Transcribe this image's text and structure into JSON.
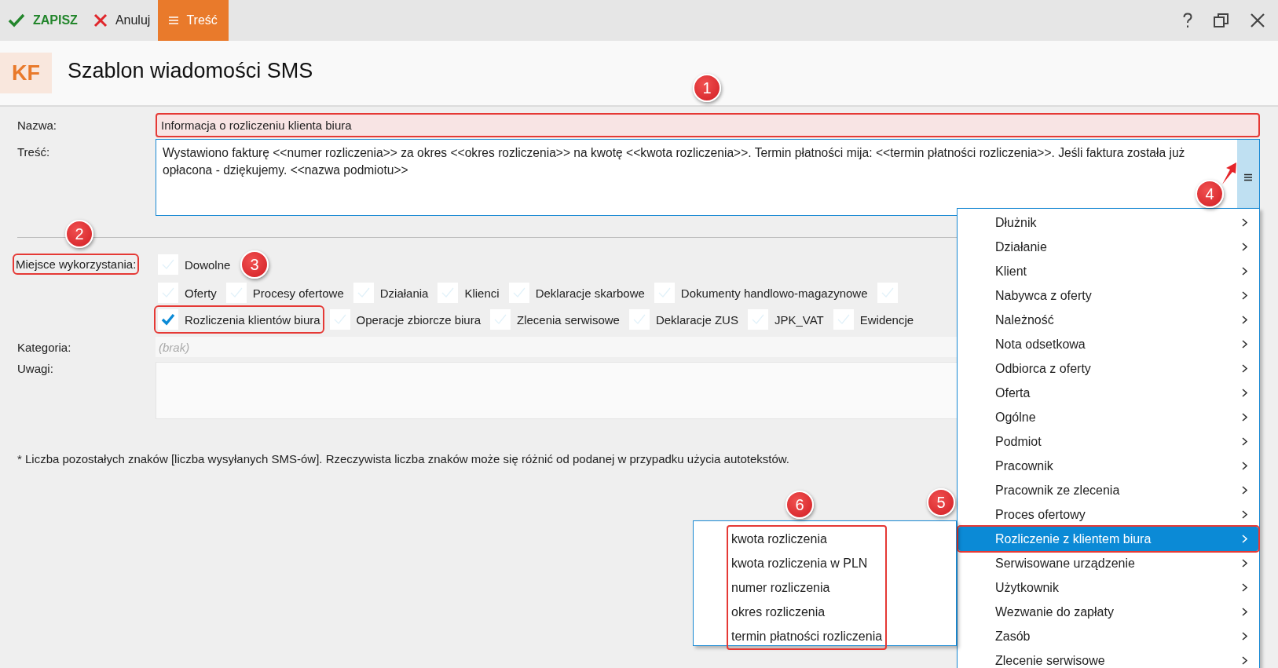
{
  "toolbar": {
    "buttons": [
      {
        "kind": "save",
        "label": "ZAPISZ"
      },
      {
        "kind": "cancel",
        "label": "Anuluj"
      },
      {
        "kind": "tab",
        "label": "Treść",
        "selected": true
      }
    ]
  },
  "header": {
    "logo": "KF",
    "title": "Szablon wiadomości SMS"
  },
  "form": {
    "name": {
      "label": "Nazwa:",
      "value": "Informacja o rozliczeniu klienta biura",
      "highlighted": true
    },
    "content": {
      "label": "Treść:",
      "value": "Wystawiono fakturę <<numer rozliczenia>> za okres <<okres rozliczenia>> na kwotę <<kwota rozliczenia>>. Termin płatności mija: <<termin płatności rozliczenia>>. Jeśli faktura została już opłacona - dziękujemy. <<nazwa podmiotu>>"
    },
    "usage": {
      "label": "Miejsce wykorzystania:",
      "highlighted": true,
      "options": [
        {
          "kind": "any",
          "label": "Dowolne",
          "checked": false,
          "highlighted": false
        },
        {
          "kind": "place",
          "label": "Oferty",
          "checked": false,
          "highlighted": false
        },
        {
          "kind": "place",
          "label": "Procesy ofertowe",
          "checked": false,
          "highlighted": false
        },
        {
          "kind": "place",
          "label": "Działania",
          "checked": false,
          "highlighted": false
        },
        {
          "kind": "place",
          "label": "Klienci",
          "checked": false,
          "highlighted": false
        },
        {
          "kind": "place",
          "label": "Deklaracje skarbowe",
          "checked": false,
          "highlighted": false
        },
        {
          "kind": "place",
          "label": "Dokumenty handlowo-magazynowe",
          "checked": false,
          "highlighted": false
        },
        {
          "kind": "place",
          "checked": false,
          "highlighted": false
        },
        {
          "kind": "place",
          "label": "Rozliczenia klientów biura",
          "checked": true,
          "highlighted": true
        },
        {
          "kind": "place",
          "label": "Operacje zbiorcze biura",
          "checked": false,
          "highlighted": false
        },
        {
          "kind": "place",
          "label": "Zlecenia serwisowe",
          "checked": false,
          "highlighted": false
        },
        {
          "kind": "place",
          "label": "Deklaracje ZUS",
          "checked": false,
          "highlighted": false
        },
        {
          "kind": "place",
          "label": "JPK_VAT",
          "checked": false,
          "highlighted": false
        },
        {
          "kind": "place",
          "label": "Ewidencje",
          "checked": false,
          "highlighted": false
        }
      ]
    },
    "category": {
      "label": "Kategoria:",
      "placeholder": "(brak)"
    },
    "notes": {
      "label": "Uwagi:"
    },
    "footnote": "* Liczba pozostałych znaków [liczba wysyłanych SMS-ów]. Rzeczywista liczba znaków może się różnić od podanej w przypadku użycia autotekstów."
  },
  "menu": {
    "items": [
      {
        "label": "Dłużnik",
        "selected": false,
        "highlighted": false
      },
      {
        "label": "Działanie",
        "selected": false,
        "highlighted": false
      },
      {
        "label": "Klient",
        "selected": false,
        "highlighted": false
      },
      {
        "label": "Nabywca z oferty",
        "selected": false,
        "highlighted": false
      },
      {
        "label": "Należność",
        "selected": false,
        "highlighted": false
      },
      {
        "label": "Nota odsetkowa",
        "selected": false,
        "highlighted": false
      },
      {
        "label": "Odbiorca z oferty",
        "selected": false,
        "highlighted": false
      },
      {
        "label": "Oferta",
        "selected": false,
        "highlighted": false
      },
      {
        "label": "Ogólne",
        "selected": false,
        "highlighted": false
      },
      {
        "label": "Podmiot",
        "selected": false,
        "highlighted": false
      },
      {
        "label": "Pracownik",
        "selected": false,
        "highlighted": false
      },
      {
        "label": "Pracownik ze zlecenia",
        "selected": false,
        "highlighted": false
      },
      {
        "label": "Proces ofertowy",
        "selected": false,
        "highlighted": false
      },
      {
        "label": "Rozliczenie z klientem biura",
        "selected": true,
        "highlighted": true
      },
      {
        "label": "Serwisowane urządzenie",
        "selected": false,
        "highlighted": false
      },
      {
        "label": "Użytkownik",
        "selected": false,
        "highlighted": false
      },
      {
        "label": "Wezwanie do zapłaty",
        "selected": false,
        "highlighted": false
      },
      {
        "label": "Zasób",
        "selected": false,
        "highlighted": false
      },
      {
        "label": "Zlecenie serwisowe",
        "selected": false,
        "highlighted": false
      }
    ]
  },
  "submenu": {
    "highlighted": true,
    "items": [
      "kwota rozliczenia",
      "kwota rozliczenia w PLN",
      "numer rozliczenia",
      "okres rozliczenia",
      "termin płatności rozliczenia"
    ]
  },
  "annotations": [
    {
      "label": "1"
    },
    {
      "label": "2"
    },
    {
      "label": "3"
    },
    {
      "label": "4"
    },
    {
      "label": "5"
    },
    {
      "label": "6"
    }
  ]
}
